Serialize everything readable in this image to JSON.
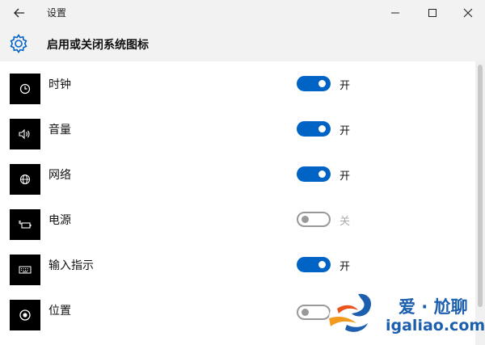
{
  "window": {
    "title": "设置"
  },
  "header": {
    "title": "启用或关闭系统图标"
  },
  "items": [
    {
      "icon": "clock-icon",
      "label": "时钟",
      "on": true,
      "state": "开"
    },
    {
      "icon": "volume-icon",
      "label": "音量",
      "on": true,
      "state": "开"
    },
    {
      "icon": "network-globe-icon",
      "label": "网络",
      "on": true,
      "state": "开"
    },
    {
      "icon": "battery-plug-icon",
      "label": "电源",
      "on": false,
      "state": "关"
    },
    {
      "icon": "keyboard-icon",
      "label": "输入指示",
      "on": true,
      "state": "开"
    },
    {
      "icon": "location-icon",
      "label": "位置",
      "on": false,
      "state": ""
    }
  ],
  "colors": {
    "toggle_on": "#0063c6",
    "toggle_off_border": "#999999",
    "header_bg": "#f2f2f2",
    "watermark": "#1b5fae"
  },
  "watermark": {
    "cn": "爱 · 尬聊",
    "en": "igaliao.com"
  }
}
